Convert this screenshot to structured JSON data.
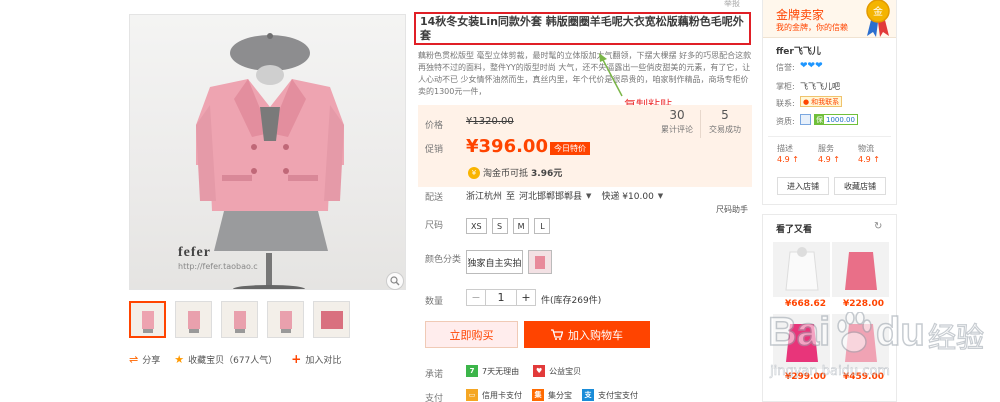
{
  "product": {
    "title": "14秋冬女装Lin同款外套 韩版圈圈羊毛呢大衣宽松版藕粉色毛呢外套",
    "description": "藕粉色贯松版型 毫型立体剪裁，最时髦的立体版加大气翻领，下摆大棵摆 好多的巧思配合这款再独特不过的面料，整件YY的版型时尚 大气，还不失逼露出一些俏皮甜美的元素，有了它，让人心动不已 少女情怀油然而生，真丝内里，年个代价是很昂贵的，咱家制作精品，商场专柜价卖的1300元一件，",
    "annotation": "复制粘贴",
    "corner_tag": "举报",
    "watermark_brand": "fefer",
    "watermark_url": "http://fefer.taobao.c"
  },
  "price": {
    "label": "价格",
    "original": "¥1320.00",
    "promo_label": "促销",
    "promo_price": "¥396.00",
    "promo_tag": "今日特价",
    "coin_text": "淘金币可抵",
    "coin_amount": "3.96元",
    "reviews_count": "30",
    "reviews_label": "累计评论",
    "sales_count": "5",
    "sales_label": "交易成功"
  },
  "delivery": {
    "label": "配送",
    "from": "浙江杭州",
    "to_word": "至",
    "to": "河北邯郸邯郸县",
    "method": "快递 ¥10.00",
    "size_helper": "尺码助手"
  },
  "size": {
    "label": "尺码",
    "options": [
      "XS",
      "S",
      "M",
      "L"
    ]
  },
  "color": {
    "label": "颜色分类",
    "option_text": "独家自主实拍"
  },
  "quantity": {
    "label": "数量",
    "minus": "−",
    "value": "1",
    "plus": "+",
    "stock": "件(库存269件)"
  },
  "actions": {
    "buy_now": "立即购买",
    "add_cart": "加入购物车",
    "share": "分享",
    "favorite": "收藏宝贝（677人气）",
    "compare": "加入对比"
  },
  "promise": {
    "label": "承诺",
    "items": [
      "7天无理由",
      "公益宝贝"
    ]
  },
  "payment": {
    "label": "支付",
    "items": [
      "信用卡支付",
      "集分宝",
      "支付宝支付"
    ]
  },
  "seller": {
    "badge_title": "金牌卖家",
    "badge_sub": "我的金牌，你的信赖",
    "name": "ffer飞飞儿",
    "credit_label": "信誉:",
    "hearts": "❤❤❤",
    "wangwang_label": "掌柜:",
    "wangwang_value": "飞飞飞儿吧",
    "contact_label": "联系:",
    "contact_value": "和我联系",
    "qual_label": "资质:",
    "deposit": "1000.00",
    "ratings": [
      {
        "label": "描述",
        "value": "4.9 ↑"
      },
      {
        "label": "服务",
        "value": "4.9 ↑"
      },
      {
        "label": "物流",
        "value": "4.9 ↑"
      }
    ],
    "enter_shop": "进入店铺",
    "fav_shop": "收藏店铺"
  },
  "also_viewed": {
    "title": "看了又看",
    "refresh": "↻",
    "items": [
      {
        "price": "¥668.62"
      },
      {
        "price": "¥228.00"
      },
      {
        "price": "¥299.00"
      },
      {
        "price": "¥459.00"
      }
    ]
  },
  "watermark": {
    "brand": "Bai",
    "brand2": "du",
    "cn": "经验",
    "url": "jingyan.baidu.com"
  }
}
